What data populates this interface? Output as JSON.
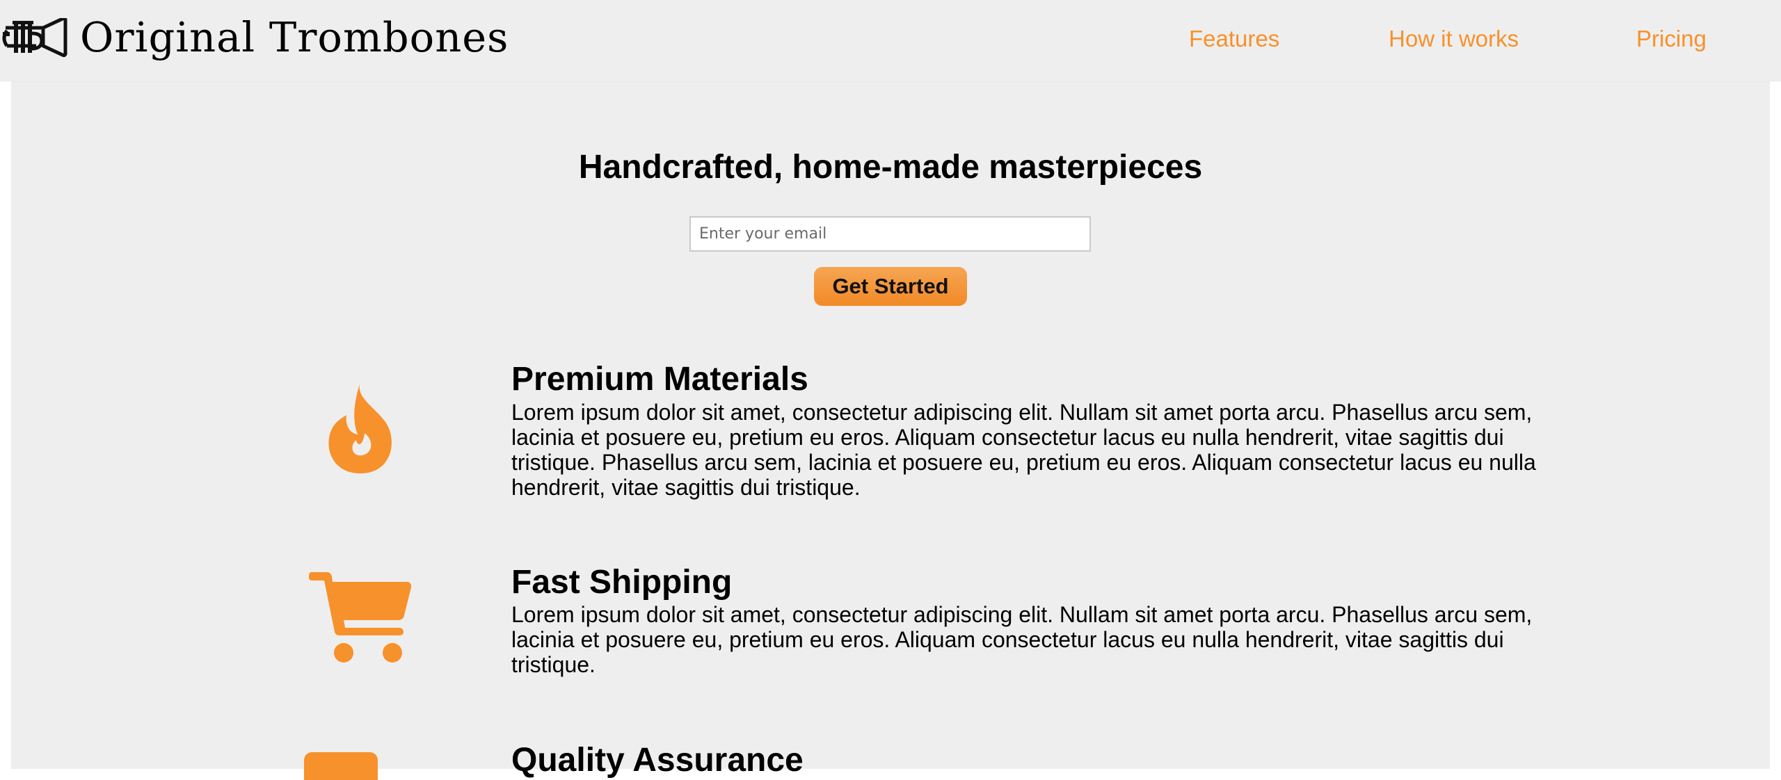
{
  "header": {
    "brand": "Original Trombones",
    "logo_icon": "trumpet-icon",
    "nav": [
      {
        "label": "Features"
      },
      {
        "label": "How it works"
      },
      {
        "label": "Pricing"
      }
    ]
  },
  "hero": {
    "title": "Handcrafted, home-made masterpieces",
    "email_placeholder": "Enter your email",
    "email_value": "",
    "cta_label": "Get Started"
  },
  "features": [
    {
      "icon": "fire-icon",
      "title": "Premium Materials",
      "description": "Lorem ipsum dolor sit amet, consectetur adipiscing elit. Nullam sit amet porta arcu. Phasellus arcu sem, lacinia et posuere eu, pretium eu eros. Aliquam consectetur lacus eu nulla hendrerit, vitae sagittis dui tristique. Phasellus arcu sem, lacinia et posuere eu, pretium eu eros. Aliquam consectetur lacus eu nulla hendrerit, vitae sagittis dui tristique."
    },
    {
      "icon": "shopping-cart-icon",
      "title": "Fast Shipping",
      "description": "Lorem ipsum dolor sit amet, consectetur adipiscing elit. Nullam sit amet porta arcu. Phasellus arcu sem, lacinia et posuere eu, pretium eu eros. Aliquam consectetur lacus eu nulla hendrerit, vitae sagittis dui tristique."
    },
    {
      "icon": "shield-icon",
      "title": "Quality Assurance",
      "description": ""
    }
  ],
  "colors": {
    "accent": "#f7912b",
    "background": "#eeeeee",
    "text": "#000000"
  }
}
